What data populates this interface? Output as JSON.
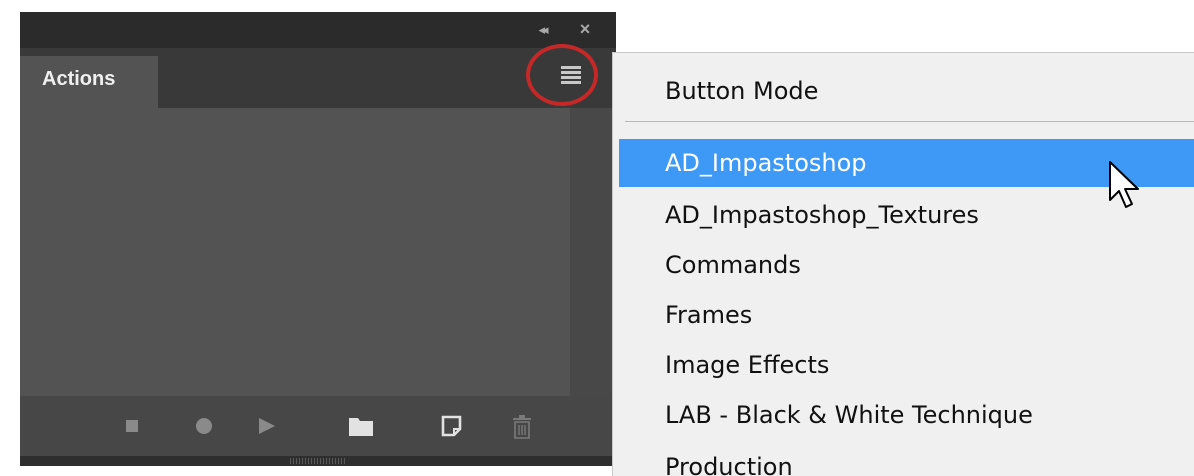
{
  "panel": {
    "tab_label": "Actions",
    "collapse_glyph": "◂◂",
    "close_glyph": "×",
    "menu_icon": "hamburger-menu-icon",
    "toolbar": {
      "stop_icon": "stop-icon",
      "record_icon": "record-icon",
      "play_icon": "play-icon",
      "folder_icon": "folder-icon",
      "new_action_icon": "new-action-icon",
      "delete_icon": "trash-icon"
    }
  },
  "flyout_menu": {
    "button_mode_label": "Button Mode",
    "items": [
      {
        "label": "AD_Impastoshop"
      },
      {
        "label": "AD_Impastoshop_Textures"
      },
      {
        "label": "Commands"
      },
      {
        "label": "Frames"
      },
      {
        "label": "Image Effects"
      },
      {
        "label": "LAB - Black & White Technique"
      },
      {
        "label": "Production"
      }
    ],
    "selected_index": 0
  },
  "colors": {
    "highlight_circle": "#c62828",
    "selection": "#3d99f5",
    "panel_background": "#535353"
  }
}
